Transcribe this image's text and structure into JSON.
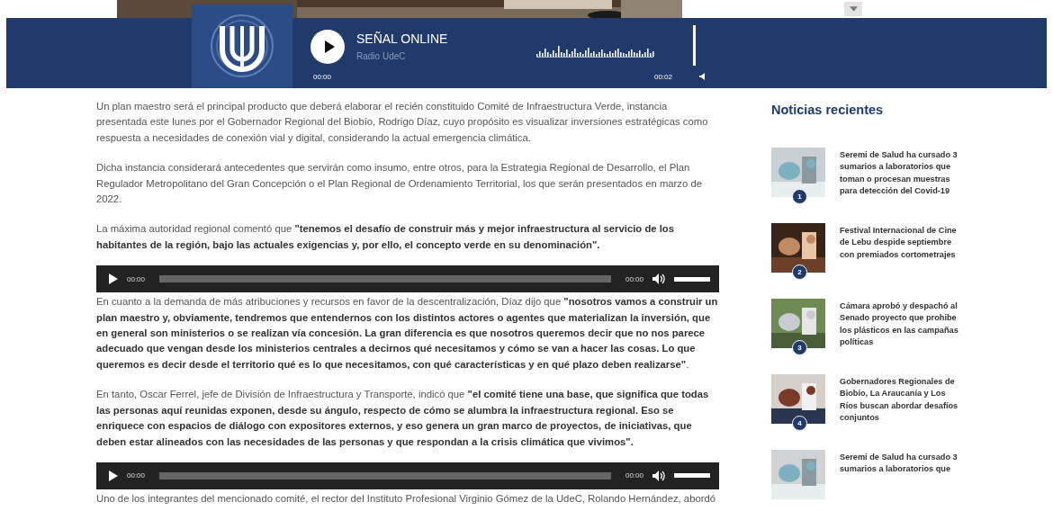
{
  "player": {
    "title": "SEÑAL ONLINE",
    "subtitle": "Radio UdeC",
    "time_elapsed": "00:00",
    "time_total": "00:02",
    "volume": {
      "level": 1
    }
  },
  "article": {
    "blocks": [
      {
        "kind": "paragraph",
        "text": "Un plan maestro será el principal producto que deberá elaborar el recién constituido Comité de Infraestructura Verde, instancia presentada este lunes por el Gobernador Regional del Biobío, Rodrigo Díaz, cuyo propósito es visualizar inversiones estratégicas como respuesta a necesidades de conexión vial y digital, considerando la actual emergencia climática."
      },
      {
        "kind": "paragraph",
        "text": "Dicha instancia considerará antecedentes que servirán como insumo, entre otros, para la Estrategia Regional de Desarrollo, el Plan Regulador Metropolitano del Gran Concepción o el Plan Regional de Ordenamiento Territorial, los que serán presentados en marzo de 2022."
      },
      {
        "kind": "paragraph",
        "text": "La máxima autoridad regional comentó que **\"tenemos el desafío de construir más y mejor infraestructura al servicio de los habitantes de la región, bajo las actuales exigencias y, por ello, el concepto verde en su denominación\".**"
      },
      {
        "kind": "audio",
        "time_current": "00:00",
        "time_total": "00:00",
        "level": 1
      },
      {
        "kind": "paragraph",
        "text": "En cuanto a la demanda de más atribuciones y recursos en favor de la descentralización, Díaz dijo que **\"nosotros vamos a construir un plan maestro y, obviamente, tendremos que entendernos con los distintos actores o agentes que materializan la inversión, que en general son ministerios o se realizan vía concesión. La gran diferencia es que nosotros queremos decir que no nos parece adecuado que vengan desde los ministerios centrales a decirnos qué necesitamos y cómo se van a hacer las cosas. Lo que queremos es decir desde el territorio qué es lo que necesitamos, con qué características y en qué plazo deben realizarse\"**."
      },
      {
        "kind": "paragraph",
        "text": "En tanto, Oscar Ferrel, jefe de División de Infraestructura y Transporte, indicó que **\"el comité tiene una base, que significa que todas las personas aquí reunidas exponen, desde su ángulo, respecto de cómo se alumbra la infraestructura regional. Eso se enriquece con espacios de diálogo con expositores externos, y eso genera un gran marco de proyectos, de iniciativas, que deben estar alineados con las necesidades de las personas y que respondan a la crisis climática que vivimos\".**"
      },
      {
        "kind": "audio",
        "time_current": "00:00",
        "time_total": "00:00",
        "level": 1
      },
      {
        "kind": "paragraph",
        "text": "Uno de los integrantes del mencionado comité, el rector del Instituto Profesional Virginio Gómez de la UdeC, Rolando Hernández, abordó"
      }
    ]
  },
  "sidebar": {
    "title": "Noticias recientes",
    "items": [
      {
        "rank": "1",
        "title": "Seremi de Salud ha cursado 3 sumarios a laboratorios que toman o procesan muestras para detección del Covid-19"
      },
      {
        "rank": "2",
        "title": "Festival Internacional de Cine de Lebu despide septiembre con premiados cortometrajes"
      },
      {
        "rank": "3",
        "title": "Cámara aprobó y despachó al Senado proyecto que prohibe los plásticos en las campañas políticas"
      },
      {
        "rank": "4",
        "title": "Gobernadores Regionales de Biobío, La Araucanía y Los Ríos buscan abordar desafíos conjuntos"
      },
      {
        "title": "Seremi de Salud ha cursado 3 sumarios a laboratorios que"
      }
    ]
  }
}
